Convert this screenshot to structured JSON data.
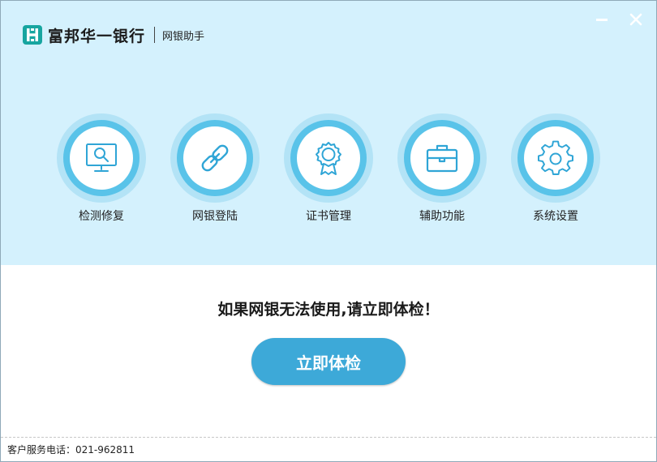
{
  "header": {
    "bank_name": "富邦华一银行",
    "app_name": "网银助手",
    "logo_icon": "fubon-logo-icon",
    "minimize_icon": "minimize-icon",
    "close_icon": "close-icon"
  },
  "features": [
    {
      "label": "检测修复",
      "icon": "monitor-search-icon"
    },
    {
      "label": "网银登陆",
      "icon": "link-chain-icon"
    },
    {
      "label": "证书管理",
      "icon": "certificate-badge-icon"
    },
    {
      "label": "辅助功能",
      "icon": "briefcase-icon"
    },
    {
      "label": "系统设置",
      "icon": "gear-icon"
    }
  ],
  "main": {
    "prompt": "如果网银无法使用,请立即体检！",
    "check_button": "立即体检"
  },
  "footer": {
    "service_phone": "客户服务电话：021-962811"
  },
  "colors": {
    "top_background": "#d4f1fd",
    "ring_outer": "#b3e3f6",
    "ring_mid": "#59c3e9",
    "accent": "#3da9d8",
    "icon_stroke": "#2fa5d6"
  }
}
